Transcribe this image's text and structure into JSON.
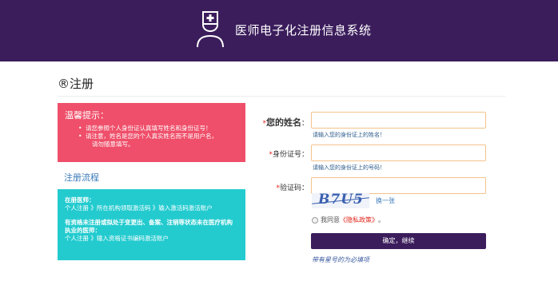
{
  "header": {
    "logo_icon": "doctor-icon",
    "title": "医师电子化注册信息系统",
    "background_color": "#3b1d5c"
  },
  "page": {
    "title": "®注册"
  },
  "tips": {
    "title": "温馨提示：",
    "items": [
      "请您参照个人身份证认真填写姓名和身份证号！",
      "请注意，姓名是您的个人真实姓名而不是用户名，",
      "请勿随意填写。"
    ],
    "background_color": "#ef4f6a"
  },
  "flow": {
    "link_label": "注册流程",
    "sections": [
      {
        "heading": "在册医师：",
        "text": "个人注册 》所在机构领取激活码 》输入激活码激活账户"
      },
      {
        "heading": "有资格未注册或拟处于变更出、备案、注销等状态未在医疗机构执业的医师：",
        "text": "个人注册 》输入资格证书编码激活账户"
      }
    ],
    "background_color": "#23cbcf"
  },
  "form": {
    "name": {
      "star": "*",
      "label_big": "您的姓名",
      "colon": "：",
      "hint": "请输入您的身份证上的姓名！"
    },
    "id_number": {
      "star": "*",
      "label": "身份证号：",
      "hint": "请输入您的身份证上的号码！"
    },
    "captcha": {
      "star": "*",
      "label": "验证码：",
      "image_text": "B7U5",
      "refresh_label": "换一张"
    },
    "agree": {
      "prefix": "我同意",
      "policy": "《隐私政策》",
      "suffix": "。"
    },
    "submit_label": "确定，继续",
    "required_note": "带有星号的为必填项"
  }
}
